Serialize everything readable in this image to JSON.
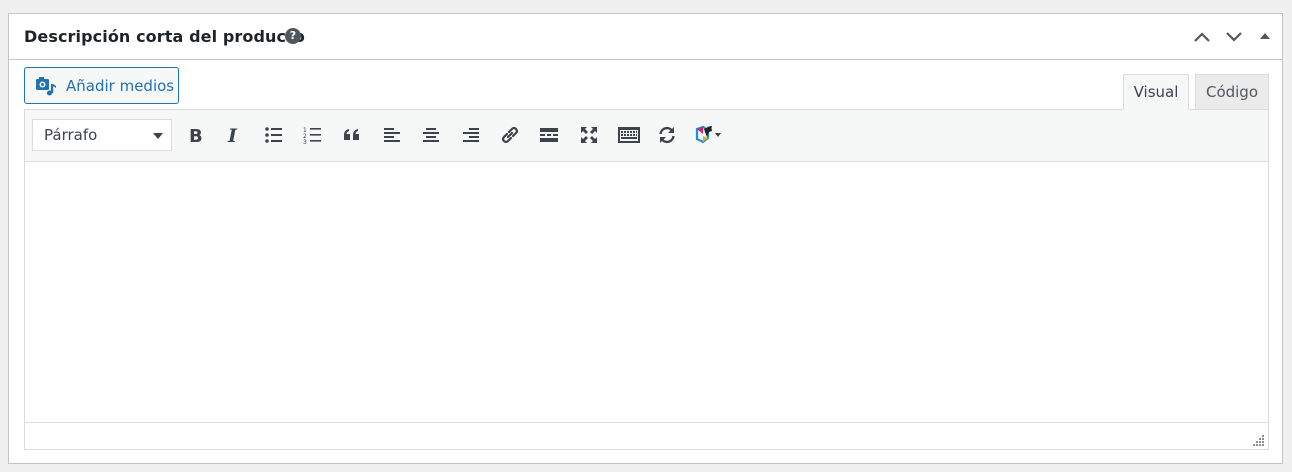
{
  "metabox": {
    "title": "Descripción corta del producto",
    "help_icon": "help-icon",
    "controls": [
      "move-up-icon",
      "move-down-icon",
      "toggle-panel-icon"
    ]
  },
  "media": {
    "add_label": "Añadir medios",
    "icon": "add-media-icon"
  },
  "tabs": [
    {
      "label": "Visual",
      "active": true
    },
    {
      "label": "Código",
      "active": false
    }
  ],
  "toolbar": {
    "format_value": "Párrafo",
    "buttons": [
      "bold-icon",
      "italic-icon",
      "bulleted-list-icon",
      "numbered-list-icon",
      "blockquote-icon",
      "align-left-icon",
      "align-center-icon",
      "align-right-icon",
      "link-icon",
      "read-more-icon",
      "fullscreen-icon",
      "toolbar-toggle-icon",
      "refresh-icon",
      "plugin-icon"
    ]
  },
  "colors": {
    "accent": "#2271b1",
    "border": "#c3c4c7",
    "icon": "#3c434a",
    "background": "#f0f0f1"
  }
}
